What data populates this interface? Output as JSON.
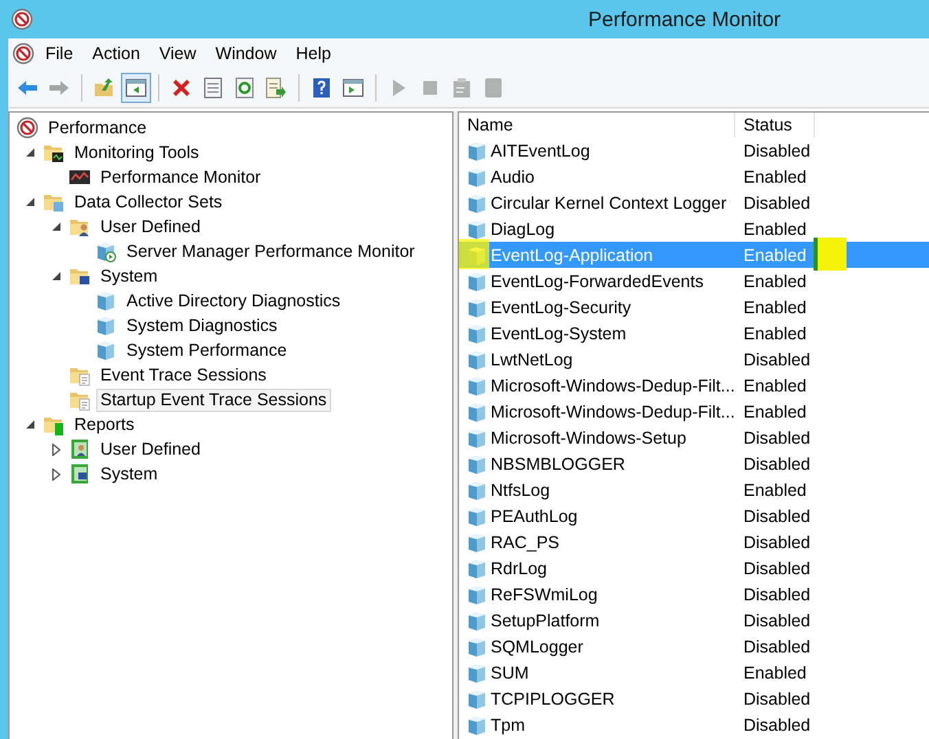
{
  "window": {
    "title": "Performance Monitor"
  },
  "menu": [
    "File",
    "Action",
    "View",
    "Window",
    "Help"
  ],
  "toolbar": [
    {
      "kind": "back",
      "disabled": false,
      "selected": false
    },
    {
      "kind": "forward",
      "disabled": true,
      "selected": false
    },
    {
      "kind": "sep"
    },
    {
      "kind": "up",
      "disabled": false,
      "selected": false
    },
    {
      "kind": "tree",
      "disabled": false,
      "selected": true
    },
    {
      "kind": "sep"
    },
    {
      "kind": "delete",
      "disabled": false,
      "selected": false
    },
    {
      "kind": "properties",
      "disabled": false,
      "selected": false
    },
    {
      "kind": "refresh",
      "disabled": false,
      "selected": false
    },
    {
      "kind": "export",
      "disabled": false,
      "selected": false
    },
    {
      "kind": "sep"
    },
    {
      "kind": "help",
      "disabled": false,
      "selected": false
    },
    {
      "kind": "action-pane",
      "disabled": false,
      "selected": false
    },
    {
      "kind": "sep"
    },
    {
      "kind": "start",
      "disabled": true,
      "selected": false
    },
    {
      "kind": "stop",
      "disabled": true,
      "selected": false
    },
    {
      "kind": "task",
      "disabled": true,
      "selected": false
    },
    {
      "kind": "square",
      "disabled": true,
      "selected": false
    }
  ],
  "tree": [
    {
      "label": "Performance",
      "kind": "app",
      "selected": false,
      "children": [
        {
          "label": "Monitoring Tools",
          "kind": "monitor-folder",
          "expanded": true,
          "selected": false,
          "children": [
            {
              "label": "Performance Monitor",
              "kind": "chart",
              "selected": false
            }
          ]
        },
        {
          "label": "Data Collector Sets",
          "kind": "dcs-folder",
          "expanded": true,
          "selected": false,
          "children": [
            {
              "label": "User Defined",
              "kind": "user-folder",
              "expanded": true,
              "selected": false,
              "children": [
                {
                  "label": "Server Manager Performance Monitor",
                  "kind": "collector-running",
                  "selected": false
                }
              ]
            },
            {
              "label": "System",
              "kind": "system-folder",
              "expanded": true,
              "selected": false,
              "children": [
                {
                  "label": "Active Directory Diagnostics",
                  "kind": "collector",
                  "selected": false
                },
                {
                  "label": "System Diagnostics",
                  "kind": "collector",
                  "selected": false
                },
                {
                  "label": "System Performance",
                  "kind": "collector",
                  "selected": false
                }
              ]
            },
            {
              "label": "Event Trace Sessions",
              "kind": "trace-folder",
              "selected": false
            },
            {
              "label": "Startup Event Trace Sessions",
              "kind": "trace-folder",
              "selected": true
            }
          ]
        },
        {
          "label": "Reports",
          "kind": "reports-folder",
          "expanded": true,
          "selected": false,
          "children": [
            {
              "label": "User Defined",
              "kind": "report-user",
              "expanded": false,
              "selected": false
            },
            {
              "label": "System",
              "kind": "report-system",
              "expanded": false,
              "selected": false
            }
          ]
        }
      ]
    }
  ],
  "table": {
    "columns": [
      "Name",
      "Status"
    ],
    "rows": [
      {
        "name": "AITEventLog",
        "status": "Disabled",
        "selected": false,
        "highlighted": false
      },
      {
        "name": "Audio",
        "status": "Enabled",
        "selected": false,
        "highlighted": false
      },
      {
        "name": "Circular Kernel Context Logger",
        "status": "Disabled",
        "selected": false,
        "highlighted": false
      },
      {
        "name": "DiagLog",
        "status": "Enabled",
        "selected": false,
        "highlighted": false
      },
      {
        "name": "EventLog-Application",
        "status": "Enabled",
        "selected": true,
        "highlighted": true
      },
      {
        "name": "EventLog-ForwardedEvents",
        "status": "Enabled",
        "selected": false,
        "highlighted": false
      },
      {
        "name": "EventLog-Security",
        "status": "Enabled",
        "selected": false,
        "highlighted": false
      },
      {
        "name": "EventLog-System",
        "status": "Enabled",
        "selected": false,
        "highlighted": false
      },
      {
        "name": "LwtNetLog",
        "status": "Disabled",
        "selected": false,
        "highlighted": false
      },
      {
        "name": "Microsoft-Windows-Dedup-Filt...",
        "status": "Enabled",
        "selected": false,
        "highlighted": false
      },
      {
        "name": "Microsoft-Windows-Dedup-Filt...",
        "status": "Enabled",
        "selected": false,
        "highlighted": false
      },
      {
        "name": "Microsoft-Windows-Setup",
        "status": "Disabled",
        "selected": false,
        "highlighted": false
      },
      {
        "name": "NBSMBLOGGER",
        "status": "Disabled",
        "selected": false,
        "highlighted": false
      },
      {
        "name": "NtfsLog",
        "status": "Enabled",
        "selected": false,
        "highlighted": false
      },
      {
        "name": "PEAuthLog",
        "status": "Disabled",
        "selected": false,
        "highlighted": false
      },
      {
        "name": "RAC_PS",
        "status": "Disabled",
        "selected": false,
        "highlighted": false
      },
      {
        "name": "RdrLog",
        "status": "Disabled",
        "selected": false,
        "highlighted": false
      },
      {
        "name": "ReFSWmiLog",
        "status": "Disabled",
        "selected": false,
        "highlighted": false
      },
      {
        "name": "SetupPlatform",
        "status": "Disabled",
        "selected": false,
        "highlighted": false
      },
      {
        "name": "SQMLogger",
        "status": "Disabled",
        "selected": false,
        "highlighted": false
      },
      {
        "name": "SUM",
        "status": "Enabled",
        "selected": false,
        "highlighted": false
      },
      {
        "name": "TCPIPLOGGER",
        "status": "Disabled",
        "selected": false,
        "highlighted": false
      },
      {
        "name": "Tpm",
        "status": "Disabled",
        "selected": false,
        "highlighted": false
      }
    ]
  }
}
